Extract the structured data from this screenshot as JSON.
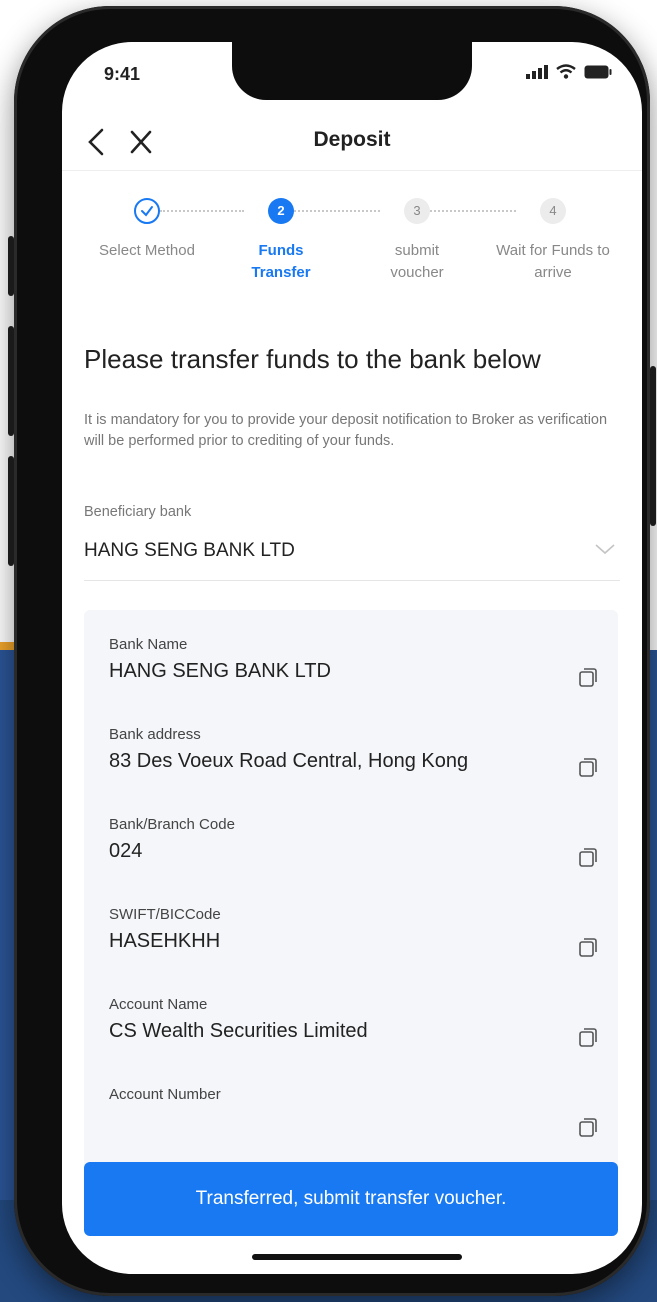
{
  "status_bar": {
    "time": "9:41"
  },
  "nav": {
    "title": "Deposit"
  },
  "steps": [
    {
      "number": "",
      "label_line1": "Select Method",
      "label_line2": ""
    },
    {
      "number": "2",
      "label_line1": "Funds",
      "label_line2": "Transfer"
    },
    {
      "number": "3",
      "label_line1": "submit",
      "label_line2": "voucher"
    },
    {
      "number": "4",
      "label_line1": "Wait for Funds to",
      "label_line2": "arrive"
    }
  ],
  "heading": "Please transfer funds to the bank below",
  "notice": "It is mandatory for you to provide your deposit notification to Broker as verification will be performed prior to crediting of your funds.",
  "beneficiary": {
    "label": "Beneficiary bank",
    "value": "HANG SENG BANK LTD"
  },
  "details": [
    {
      "label": "Bank Name",
      "value": "HANG SENG BANK LTD"
    },
    {
      "label": "Bank address",
      "value": "83 Des Voeux Road Central, Hong Kong"
    },
    {
      "label": "Bank/Branch Code",
      "value": "024"
    },
    {
      "label": "SWIFT/BICCode",
      "value": "HASEHKHH"
    },
    {
      "label": "Account Name",
      "value": "CS Wealth Securities Limited"
    },
    {
      "label": "Account Number",
      "value": ""
    }
  ],
  "submit_label": "Transferred, submit transfer voucher.",
  "colors": {
    "accent": "#1879f2",
    "backdrop_blue": "#2b5597",
    "backdrop_orange": "#f0a52a",
    "card_bg": "#f4f6f9"
  },
  "icons": [
    "back-icon",
    "close-icon",
    "check-icon",
    "chevron-down-icon",
    "copy-icon",
    "signal-icon",
    "wifi-icon",
    "battery-icon"
  ]
}
